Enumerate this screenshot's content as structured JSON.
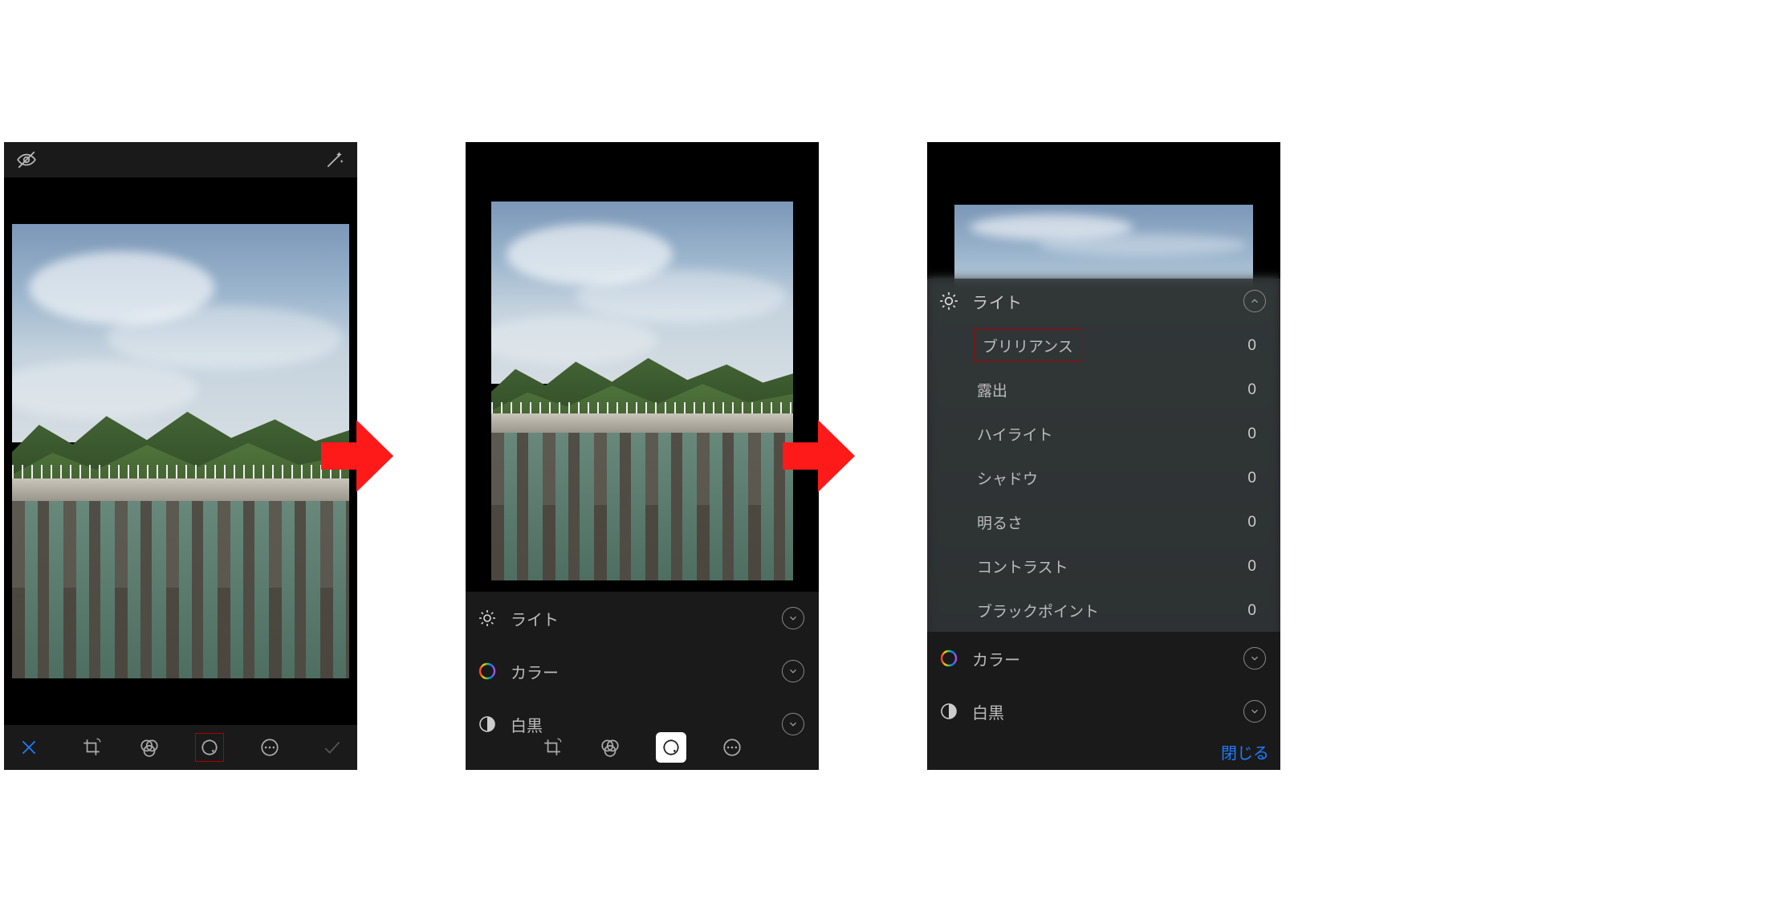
{
  "icons": {
    "eye": "eye-hidden-icon",
    "wand": "magic-wand-icon",
    "cancel": "cancel",
    "crop": "crop",
    "filters": "filters",
    "adjust": "adjust",
    "more": "more",
    "done": "done"
  },
  "adjust": {
    "light": {
      "label": "ライト"
    },
    "color": {
      "label": "カラー"
    },
    "bw": {
      "label": "白黒"
    }
  },
  "light_sub": {
    "brilliance": {
      "label": "ブリリアンス",
      "value": "0"
    },
    "exposure": {
      "label": "露出",
      "value": "0"
    },
    "highlights": {
      "label": "ハイライト",
      "value": "0"
    },
    "shadows": {
      "label": "シャドウ",
      "value": "0"
    },
    "brightness": {
      "label": "明るさ",
      "value": "0"
    },
    "contrast": {
      "label": "コントラスト",
      "value": "0"
    },
    "blackpoint": {
      "label": "ブラックポイント",
      "value": "0"
    }
  },
  "close_button": "閉じる"
}
